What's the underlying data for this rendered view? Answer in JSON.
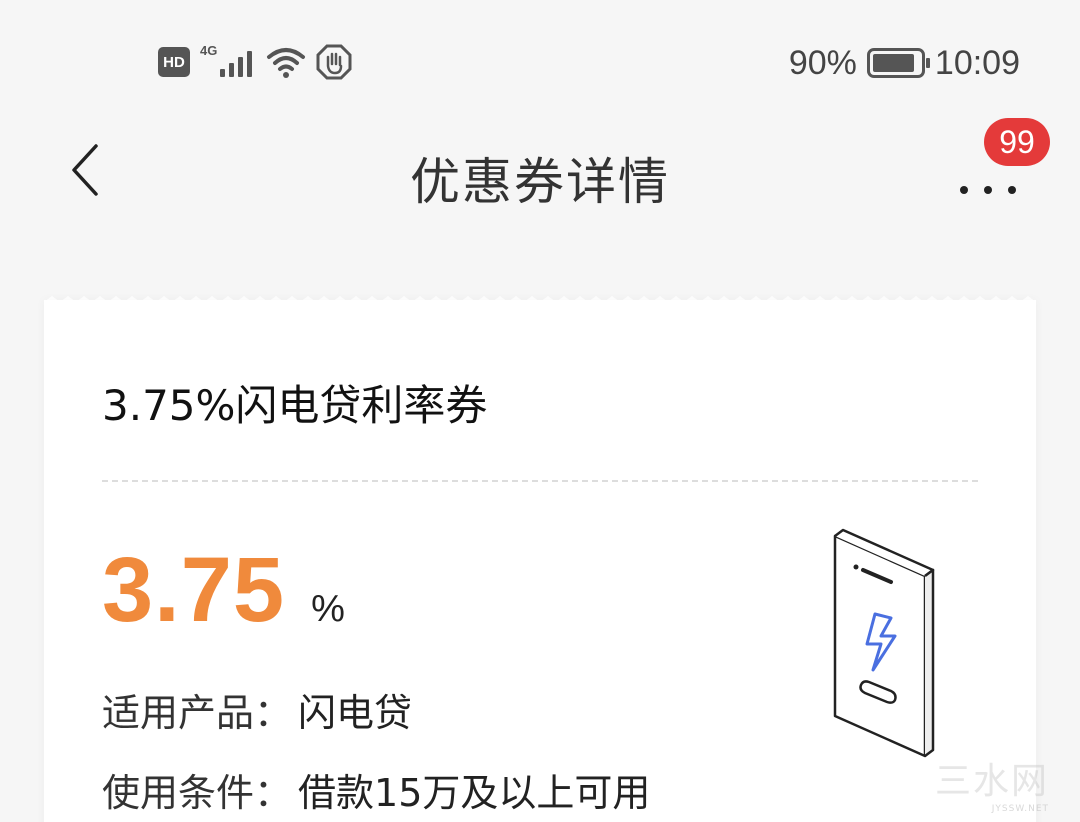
{
  "status_bar": {
    "hd": "HD",
    "network": "4G",
    "battery_percent": "90%",
    "battery_level": 0.9,
    "time": "10:09"
  },
  "header": {
    "title": "优惠券详情",
    "badge_count": "99",
    "icons": [
      "back-chevron-icon",
      "more-dots-icon"
    ]
  },
  "coupon": {
    "title": "3.75%闪电贷利率券",
    "rate_value": "3.75",
    "rate_unit": "%",
    "product_label": "适用产品：",
    "product_value": "闪电贷",
    "condition_label": "使用条件：",
    "condition_value": "借款15万及以上可用",
    "illustration": "phone-lightning-icon",
    "accent_color": "#f08a3c"
  },
  "watermark": {
    "text": "三水网",
    "sub": "JYSSW.NET"
  }
}
